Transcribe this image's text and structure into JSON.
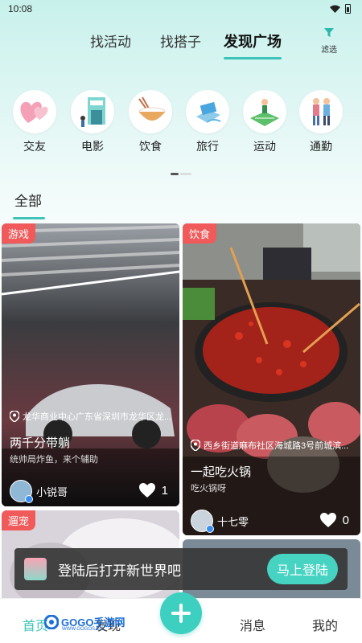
{
  "status_bar": {
    "time": "10:08"
  },
  "top_tabs": [
    {
      "label": "找活动"
    },
    {
      "label": "找搭子"
    },
    {
      "label": "发现广场"
    }
  ],
  "filter": {
    "label": "滤选",
    "icon": "funnel-icon"
  },
  "categories": [
    {
      "label": "交友",
      "icon": "hearts-icon"
    },
    {
      "label": "电影",
      "icon": "cinema-icon"
    },
    {
      "label": "饮食",
      "icon": "rice-bowl-icon"
    },
    {
      "label": "旅行",
      "icon": "travel-icon"
    },
    {
      "label": "运动",
      "icon": "sports-icon"
    },
    {
      "label": "通勤",
      "icon": "commute-icon"
    }
  ],
  "sub_tab": {
    "label": "全部"
  },
  "cards": [
    {
      "tag": "游戏",
      "location": "龙华商业中心广东省深圳市龙华区龙...",
      "title": "两千分带躺",
      "desc": "统帅局炸鱼，来个辅助",
      "author": "小锐哥",
      "likes": "1"
    },
    {
      "tag": "饮食",
      "location": "西乡街道麻布社区海城路3号前城滨...",
      "title": "一起吃火锅",
      "desc": "吃火锅呀",
      "author": "十七零",
      "likes": "0"
    },
    {
      "tag": "遛宠"
    }
  ],
  "login_banner": {
    "text": "登陆后打开新世界吧",
    "button": "马上登陆"
  },
  "bottom_nav": [
    {
      "label": "首页"
    },
    {
      "label": "发现"
    },
    {
      "label": "消息"
    },
    {
      "label": "我的"
    }
  ],
  "watermark": {
    "text": "GOGO手游网",
    "sub": "WWW.GOGOS.CN"
  },
  "colors": {
    "accent": "#3cc4b8",
    "tag": "#f05a5a",
    "login_button": "#47d3c2"
  }
}
